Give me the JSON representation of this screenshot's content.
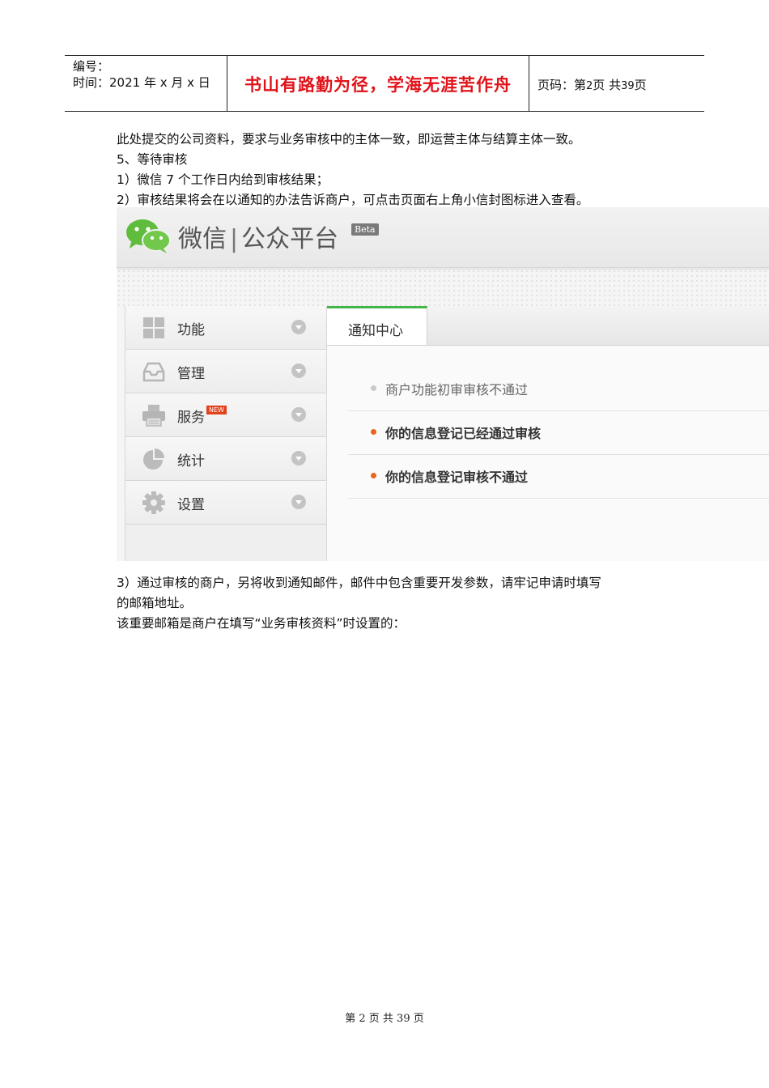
{
  "header": {
    "serial_label": "编号：",
    "date_label": "时间：2021 年 x 月 x 日",
    "motto": "书山有路勤为径，学海无涯苦作舟",
    "page_prefix": "页码：第",
    "page_num": "2",
    "page_mid": "页  共",
    "page_total": "39",
    "page_suffix": "页"
  },
  "body": {
    "p1": "此处提交的公司资料，要求与业务审核中的主体一致，即运营主体与结算主体一致。",
    "p2": "5、等待审核",
    "p3": "1）微信 7 个工作日内给到审核结果；",
    "p4": "2）审核结果将会在以通知的办法告诉商户，可点击页面右上角小信封图标进入查看。",
    "p5": "3）通过审核的商户，另将收到通知邮件，邮件中包含重要开发参数，请牢记申请时填写",
    "p6": "的邮箱地址。",
    "p7": "该重要邮箱是商户在填写“业务审核资料”时设置的："
  },
  "screenshot": {
    "brand": "微信",
    "separator": "|",
    "platform": "公众平台",
    "beta": "Beta",
    "sidebar": [
      {
        "label": "功能",
        "icon": "grid-icon"
      },
      {
        "label": "管理",
        "icon": "inbox-icon"
      },
      {
        "label": "服务",
        "icon": "printer-icon",
        "badge": "NEW"
      },
      {
        "label": "统计",
        "icon": "pie-chart-icon"
      },
      {
        "label": "设置",
        "icon": "gear-icon"
      }
    ],
    "tab": "通知中心",
    "notices": [
      {
        "text": "商户功能初审审核不通过",
        "status": "read"
      },
      {
        "text": "你的信息登记已经通过审核",
        "status": "unread"
      },
      {
        "text": "你的信息登记审核不通过",
        "status": "unread"
      }
    ],
    "colors": {
      "accent_green": "#44b549",
      "unread_dot": "#e8661c",
      "motto_red": "#e0131a"
    }
  },
  "footer": {
    "text": "第 2 页 共 39 页"
  }
}
